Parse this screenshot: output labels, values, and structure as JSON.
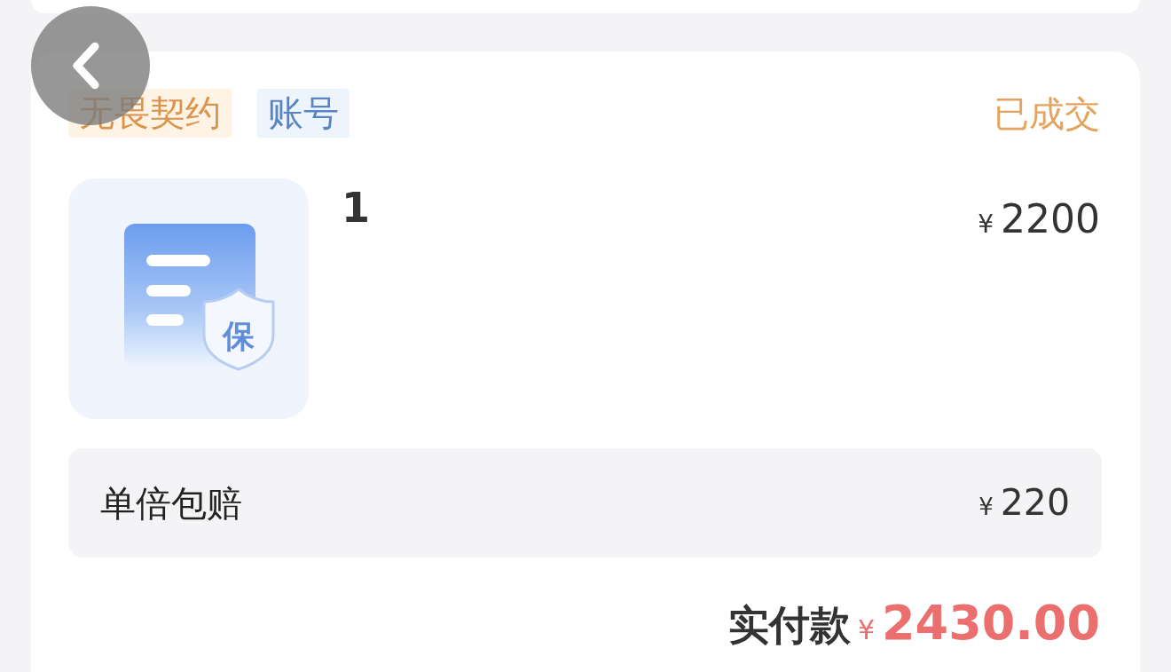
{
  "order": {
    "tags": [
      {
        "label": "无畏契约",
        "kind": "game"
      },
      {
        "label": "账号",
        "kind": "category"
      }
    ],
    "status": "已成交",
    "product": {
      "thumbnail_badge": "保",
      "title": "1",
      "price": {
        "currency": "¥",
        "amount": "2200"
      }
    },
    "insurance": {
      "label": "单倍包赔",
      "price": {
        "currency": "¥",
        "amount": "220"
      }
    },
    "total": {
      "label": "实付款",
      "currency": "¥",
      "amount": "2430.00"
    }
  }
}
